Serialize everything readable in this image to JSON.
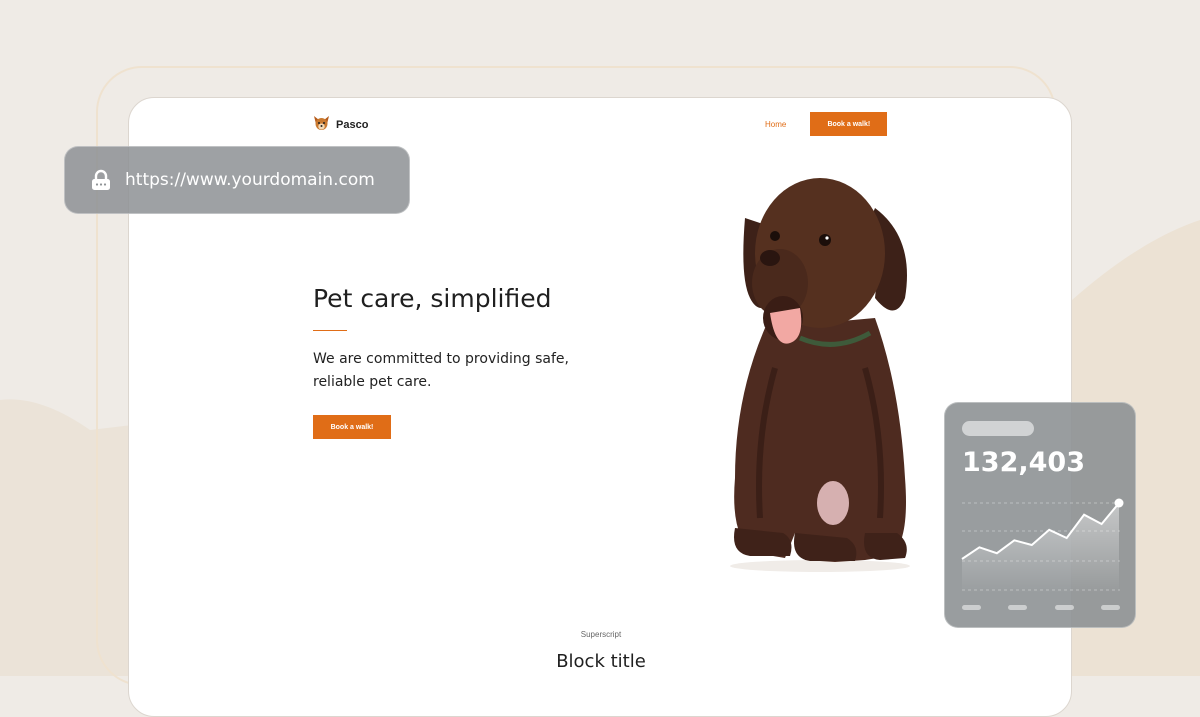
{
  "browser": {
    "url": "https://www.yourdomain.com",
    "icon": "lock-icon"
  },
  "site": {
    "brand": "Pasco",
    "logo_icon": "dog-face-icon",
    "nav": {
      "home": "Home",
      "book": "Book a walk!"
    }
  },
  "hero": {
    "title": "Pet care, simplified",
    "subtitle": "We are committed to providing safe, reliable pet care.",
    "cta": "Book a walk!",
    "image": "chocolate-labrador-puppy"
  },
  "section": {
    "superscript": "Superscript",
    "title": "Block title"
  },
  "stat_card": {
    "value": "132,403",
    "chart_data": {
      "type": "area",
      "values": [
        0,
        10,
        5,
        16,
        12,
        25,
        18,
        38,
        30,
        48
      ]
    }
  },
  "colors": {
    "accent": "#e06d17",
    "page_background": "#efebe6",
    "overlay_gray": "#8e9295"
  }
}
